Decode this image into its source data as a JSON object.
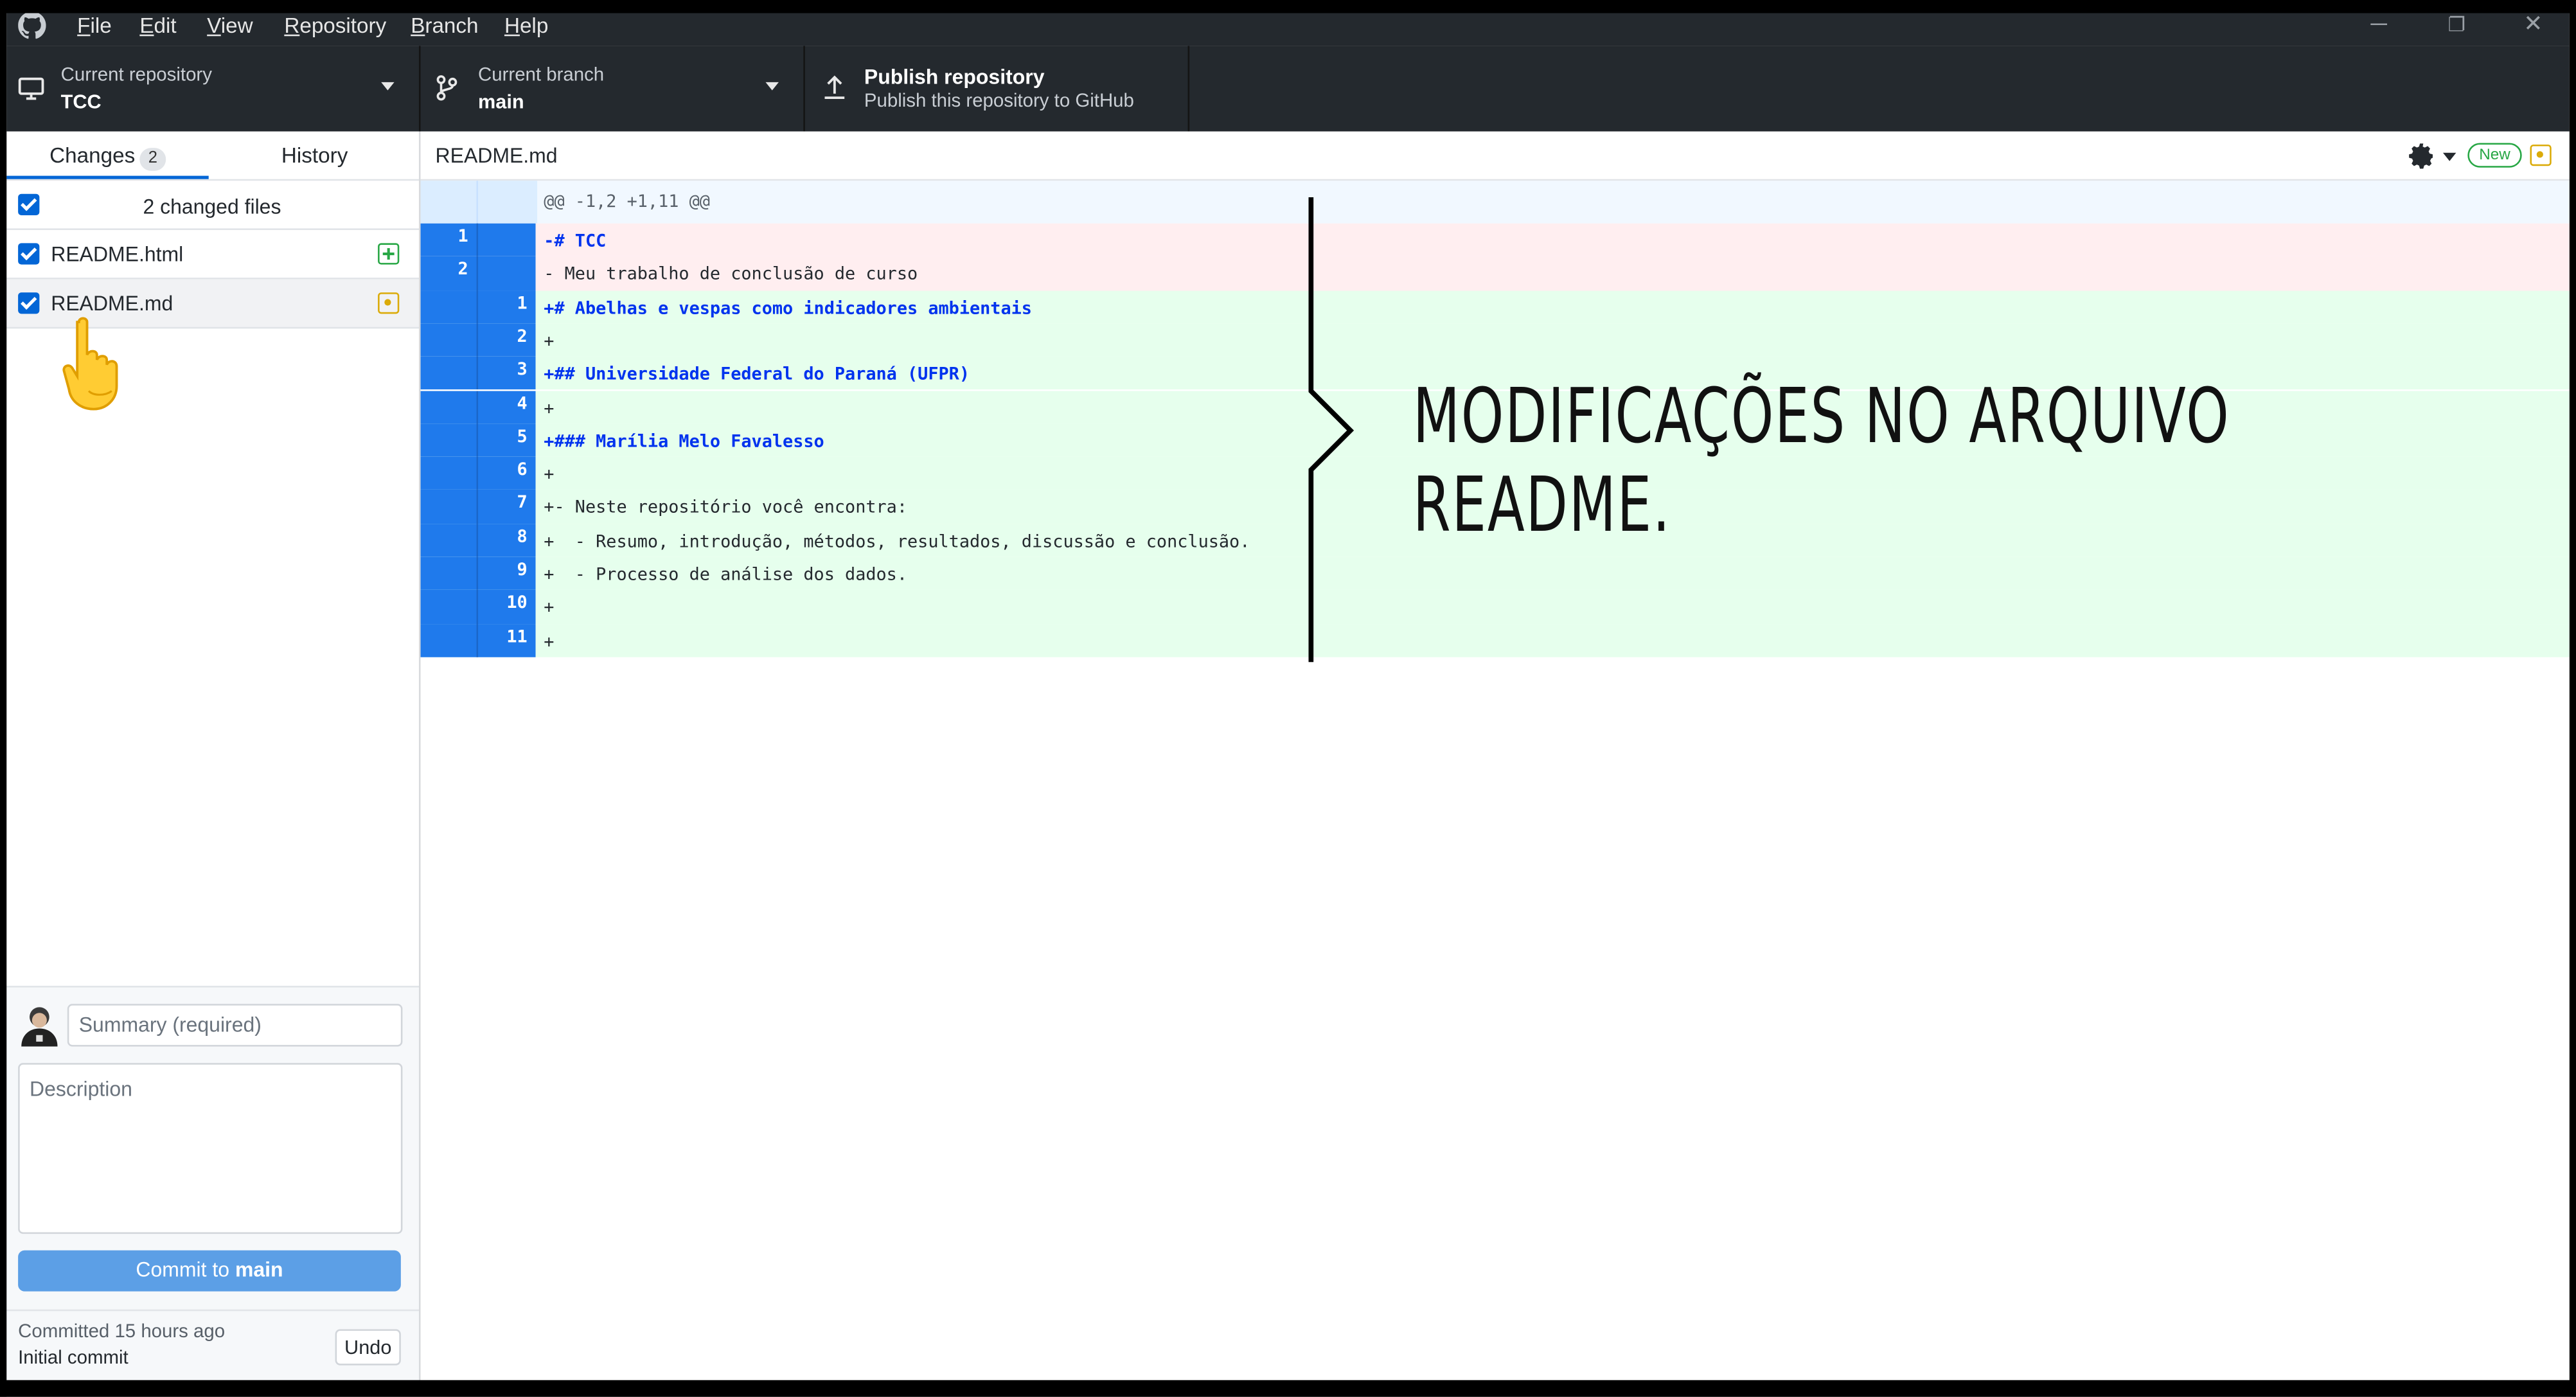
{
  "menu": {
    "items": [
      {
        "u": "F",
        "rest": "ile"
      },
      {
        "u": "E",
        "rest": "dit"
      },
      {
        "u": "V",
        "rest": "iew"
      },
      {
        "u": "R",
        "rest": "epository"
      },
      {
        "u": "B",
        "rest": "ranch"
      },
      {
        "u": "H",
        "rest": "elp"
      }
    ]
  },
  "toolbar": {
    "repo_label": "Current repository",
    "repo_value": "TCC",
    "branch_label": "Current branch",
    "branch_value": "main",
    "publish_title": "Publish repository",
    "publish_subtitle": "Publish this repository to GitHub"
  },
  "sidebar": {
    "tab_changes": "Changes",
    "tab_changes_count": "2",
    "tab_history": "History",
    "changed_files_label": "2 changed files",
    "files": [
      {
        "name": "README.html",
        "status": "added",
        "status_color": "#28a745"
      },
      {
        "name": "README.md",
        "status": "modified",
        "status_color": "#dbab09"
      }
    ],
    "summary_placeholder": "Summary (required)",
    "description_placeholder": "Description",
    "commit_prefix": "Commit to ",
    "commit_branch": "main",
    "last_commit_time": "Committed 15 hours ago",
    "last_commit_message": "Initial commit",
    "undo_label": "Undo"
  },
  "diff": {
    "file_name": "README.md",
    "new_badge": "New",
    "hunk_header": "@@ -1,2 +1,11 @@",
    "lines": [
      {
        "old": "1",
        "new": "",
        "type": "del",
        "text": "-# TCC"
      },
      {
        "old": "2",
        "new": "",
        "type": "del",
        "text": "- Meu trabalho de conclusão de curso"
      },
      {
        "old": "",
        "new": "1",
        "type": "add",
        "text": "+# Abelhas e vespas como indicadores ambientais"
      },
      {
        "old": "",
        "new": "2",
        "type": "add",
        "text": "+"
      },
      {
        "old": "",
        "new": "3",
        "type": "add",
        "text": "+## Universidade Federal do Paraná (UFPR)"
      },
      {
        "old": "",
        "new": "4",
        "type": "add",
        "text": "+"
      },
      {
        "old": "",
        "new": "5",
        "type": "add",
        "text": "+### Marília Melo Favalesso"
      },
      {
        "old": "",
        "new": "6",
        "type": "add",
        "text": "+"
      },
      {
        "old": "",
        "new": "7",
        "type": "add",
        "text": "+- Neste repositório você encontra:"
      },
      {
        "old": "",
        "new": "8",
        "type": "add",
        "text": "+  - Resumo, introdução, métodos, resultados, discussão e conclusão."
      },
      {
        "old": "",
        "new": "9",
        "type": "add",
        "text": "+  - Processo de análise dos dados."
      },
      {
        "old": "",
        "new": "10",
        "type": "add",
        "text": "+"
      },
      {
        "old": "",
        "new": "11",
        "type": "add",
        "text": "+"
      }
    ]
  },
  "annotation": "MODIFICAÇÕES NO ARQUIVO README."
}
